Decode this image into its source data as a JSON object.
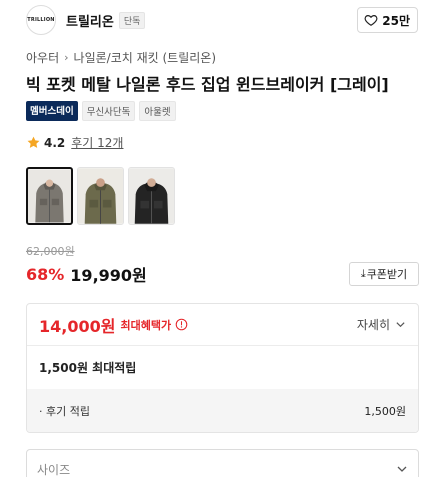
{
  "brand": {
    "logo_text": "TRILLION",
    "name": "트릴리온",
    "badge": "단독"
  },
  "like": {
    "count": "25만",
    "icon": "heart-icon"
  },
  "breadcrumb": {
    "level1": "아우터",
    "level2": "나일론/코치 재킷 (트릴리온)"
  },
  "product": {
    "title": "빅 포켓 메탈 나일론 후드 집업 윈드브레이커 [그레이]",
    "tags": [
      "멤버스데이",
      "무신사단독",
      "아울렛"
    ]
  },
  "rating": {
    "score": "4.2",
    "reviews": "후기 12개",
    "icon": "star-icon",
    "star_color": "#f5a623"
  },
  "thumbnails": [
    {
      "color": "gray",
      "selected": true
    },
    {
      "color": "khaki",
      "selected": false
    },
    {
      "color": "black",
      "selected": false
    }
  ],
  "price": {
    "original": "62,000원",
    "discount": "68%",
    "sale": "19,990원",
    "coupon_label": "쿠폰받기"
  },
  "benefit": {
    "max_price": "14,000원",
    "max_label": "최대혜택가",
    "detail_label": "자세히",
    "points": "1,500원 최대적립",
    "review_label": "· 후기 적립",
    "review_amount": "1,500원"
  },
  "size_select": {
    "placeholder": "사이즈"
  },
  "colors": {
    "accent_red": "#e5262a",
    "member_badge": "#0b2a5a"
  }
}
